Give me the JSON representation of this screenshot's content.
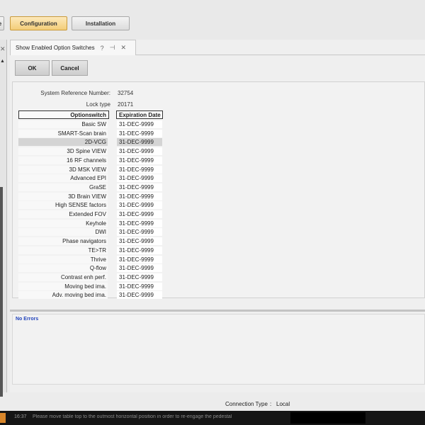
{
  "top_nav": {
    "partial_label": "e",
    "configuration_label": "Configuration",
    "installation_label": "Installation"
  },
  "tab": {
    "title": "Show Enabled Option Switches",
    "help_icon": "question-mark-icon",
    "pin_icon": "pin-icon",
    "close_icon": "close-icon"
  },
  "buttons": {
    "ok": "OK",
    "cancel": "Cancel"
  },
  "info": {
    "system_ref_label": "System Reference Number:",
    "system_ref_value": "32754",
    "lock_type_label": "Lock type",
    "lock_type_value": "20171"
  },
  "table": {
    "headers": [
      "Optionswitch",
      "Expiration Date"
    ],
    "rows": [
      {
        "name": "Basic SW",
        "date": "31-DEC-9999"
      },
      {
        "name": "SMART-Scan brain",
        "date": "31-DEC-9999"
      },
      {
        "name": "2D-VCG",
        "date": "31-DEC-9999"
      },
      {
        "name": "3D Spine VIEW",
        "date": "31-DEC-9999"
      },
      {
        "name": "16 RF channels",
        "date": "31-DEC-9999"
      },
      {
        "name": "3D MSK VIEW",
        "date": "31-DEC-9999"
      },
      {
        "name": "Advanced EPI",
        "date": "31-DEC-9999"
      },
      {
        "name": "GraSE",
        "date": "31-DEC-9999"
      },
      {
        "name": "3D Brain VIEW",
        "date": "31-DEC-9999"
      },
      {
        "name": "High SENSE factors",
        "date": "31-DEC-9999"
      },
      {
        "name": "Extended FOV",
        "date": "31-DEC-9999"
      },
      {
        "name": "Keyhole",
        "date": "31-DEC-9999"
      },
      {
        "name": "DWI",
        "date": "31-DEC-9999"
      },
      {
        "name": "Phase navigators",
        "date": "31-DEC-9999"
      },
      {
        "name": "TE>TR",
        "date": "31-DEC-9999"
      },
      {
        "name": "Thrive",
        "date": "31-DEC-9999"
      },
      {
        "name": "Q-flow",
        "date": "31-DEC-9999"
      },
      {
        "name": "Contrast enh perf.",
        "date": "31-DEC-9999"
      },
      {
        "name": "Moving bed ima.",
        "date": "31-DEC-9999"
      },
      {
        "name": "Adv. moving bed ima.",
        "date": "31-DEC-9999"
      }
    ]
  },
  "messages": {
    "status": "No Errors"
  },
  "status_bar": {
    "connection_label": "Connection Type",
    "separator": ":",
    "connection_value": "Local"
  },
  "taskbar": {
    "time": "16:37",
    "message": "Please move table top to the outmost horizontal position in order to re-engage the pedestal"
  }
}
